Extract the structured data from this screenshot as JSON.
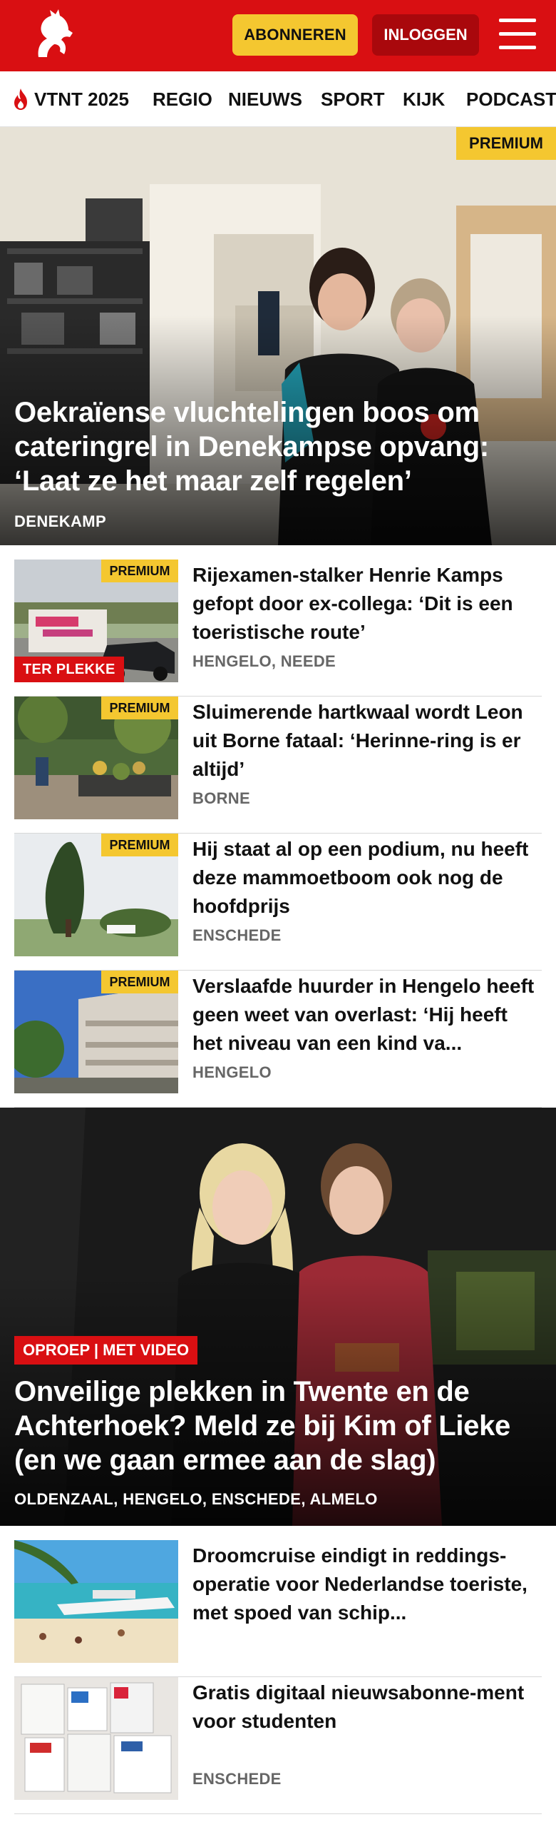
{
  "header": {
    "subscribe_label": "ABONNEREN",
    "login_label": "INLOGGEN",
    "brand_color": "#d90f12",
    "accent_color": "#f4c730"
  },
  "nav": {
    "items": [
      "VTNT 2025",
      "REGIO",
      "NIEUWS",
      "SPORT",
      "KIJK",
      "PODCAST"
    ]
  },
  "hero": {
    "badge": "PREMIUM",
    "title": "Oekraïense vluchtelingen boos om cateringrel in Denekampse opvang: ‘Laat ze het maar zelf regelen’",
    "location": "DENEKAMP"
  },
  "articles": [
    {
      "badge": "PREMIUM",
      "tag": "TER PLEKKE",
      "title": "Rijexamen-stalker Henrie Kamps gefopt door ex-collega: ‘Dit is een toeristische route’",
      "location": "HENGELO, NEEDE"
    },
    {
      "badge": "PREMIUM",
      "title": "Sluimerende hartkwaal wordt Leon uit Borne fataal: ‘Herinne-ring is er altijd’",
      "location": "BORNE"
    },
    {
      "badge": "PREMIUM",
      "title": "Hij staat al op een podium, nu heeft deze mammoetboom ook nog de hoofdprijs",
      "location": "ENSCHEDE"
    },
    {
      "badge": "PREMIUM",
      "title": "Verslaafde huurder in Hengelo heeft geen weet van overlast: ‘Hij heeft het niveau van een kind va...",
      "location": "HENGELO"
    }
  ],
  "hero2": {
    "tag": "OPROEP | MET VIDEO",
    "title": "Onveilige plekken in Twente en de Achterhoek? Meld ze bij Kim of Lieke (en we gaan ermee aan de slag)",
    "location": "OLDENZAAL, HENGELO, ENSCHEDE, ALMELO"
  },
  "articles2": [
    {
      "title": "Droomcruise eindigt in reddings-operatie voor Nederlandse toeriste, met spoed van schip...",
      "location": ""
    },
    {
      "title": "Gratis digitaal nieuwsabonne-ment voor studenten",
      "location": "ENSCHEDE"
    }
  ]
}
